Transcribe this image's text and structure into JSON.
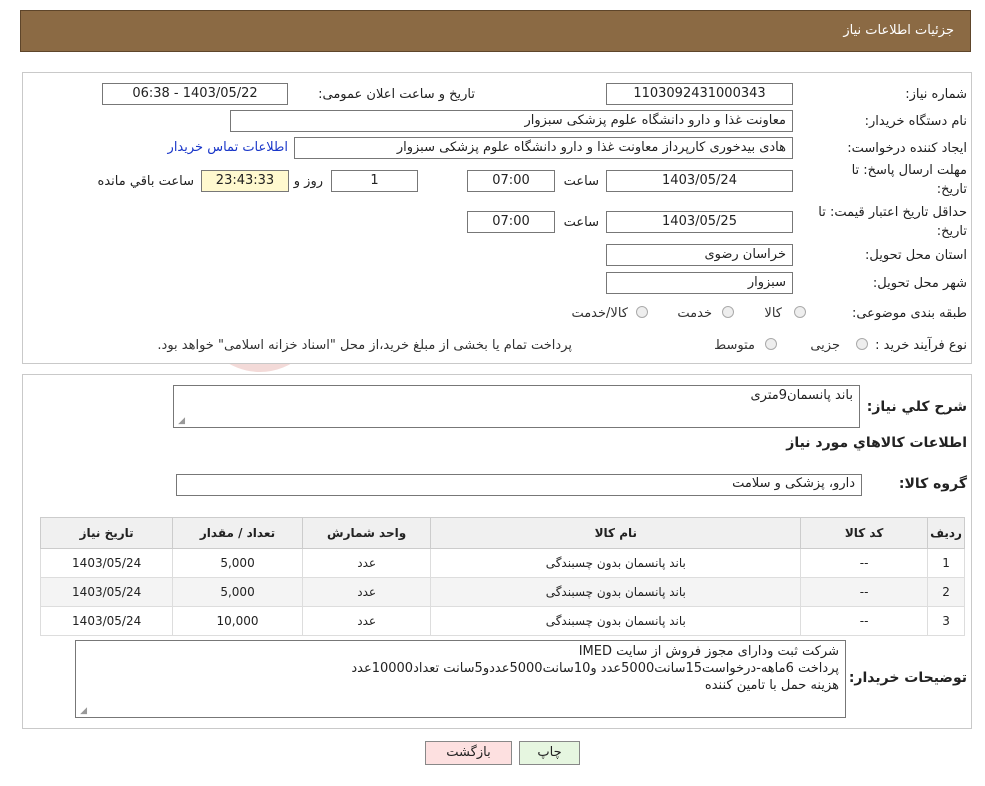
{
  "header": {
    "title": "جزئیات اطلاعات نیاز"
  },
  "form": {
    "need_number_label": "شماره نیاز:",
    "need_number": "1103092431000343",
    "announce_label": "تاریخ و ساعت اعلان عمومی:",
    "announce_value": "1403/05/22 - 06:38",
    "buyer_org_label": "نام دستگاه خریدار:",
    "buyer_org": "معاونت غذا و دارو   دانشگاه علوم پزشکی سبزوار",
    "requester_label": "ایجاد کننده درخواست:",
    "requester": "هادی بیدخوری کارپرداز معاونت غذا و دارو   دانشگاه علوم پزشکی سبزوار",
    "contact_link": "اطلاعات تماس خریدار",
    "deadline_label_1": "مهلت ارسال پاسخ: تا",
    "deadline_label_2": "تاریخ:",
    "deadline_date": "1403/05/24",
    "time_label": "ساعت",
    "deadline_time": "07:00",
    "days_value": "1",
    "days_label": "روز و",
    "remaining_time": "23:43:33",
    "remaining_label": "ساعت باقي مانده",
    "validity_label_1": "حداقل تاریخ اعتبار قیمت: تا",
    "validity_label_2": "تاریخ:",
    "validity_date": "1403/05/25",
    "validity_time_label": "ساعت",
    "validity_time": "07:00",
    "province_label": "استان محل تحویل:",
    "province": "خراسان رضوی",
    "city_label": "شهر محل تحویل:",
    "city": "سبزوار",
    "category_label": "طبقه بندی موضوعی:",
    "category_options": [
      "کالا",
      "خدمت",
      "کالا/خدمت"
    ],
    "process_label": "نوع فرآیند خرید :",
    "process_options": [
      "جزیی",
      "متوسط"
    ],
    "payment_note": "پرداخت تمام یا بخشی از مبلغ خرید،از محل \"اسناد خزانه اسلامی\" خواهد بود."
  },
  "summary": {
    "description_label": "شرح کلي نياز:",
    "description": "باند پانسمان9متری",
    "goods_info_title": "اطلاعات کالاهاي مورد نياز",
    "goods_group_label": "گروه کالا:",
    "goods_group": "دارو، پزشکی و سلامت"
  },
  "table": {
    "headers": [
      "رديف",
      "کد کالا",
      "نام کالا",
      "واحد شمارش",
      "تعداد / مقدار",
      "تاريخ نياز"
    ],
    "rows": [
      [
        "1",
        "--",
        "باند پانسمان بدون چسبندگی",
        "عدد",
        "5,000",
        "1403/05/24"
      ],
      [
        "2",
        "--",
        "باند پانسمان بدون چسبندگی",
        "عدد",
        "5,000",
        "1403/05/24"
      ],
      [
        "3",
        "--",
        "باند پانسمان بدون چسبندگی",
        "عدد",
        "10,000",
        "1403/05/24"
      ]
    ]
  },
  "buyer_notes": {
    "label": "توضیحات خریدار:",
    "lines": [
      "شرکت ثبت ودارای مجوز فروش از سایت IMED",
      "پرداخت 6ماهه-درخواست15سانت5000عدد و10سانت5000عددو5سانت تعداد10000عدد",
      "هزینه حمل با تامین کننده"
    ]
  },
  "buttons": {
    "print": "چاپ",
    "back": "بازگشت"
  },
  "watermark": {
    "text": "AriaTender.neT"
  },
  "colors": {
    "header_bg": "#8b6a44",
    "link": "#1a37c9",
    "remaining_bg": "#fff9cf",
    "back_btn_bg": "#fde0e0",
    "print_btn_bg": "#e6f6e0"
  }
}
